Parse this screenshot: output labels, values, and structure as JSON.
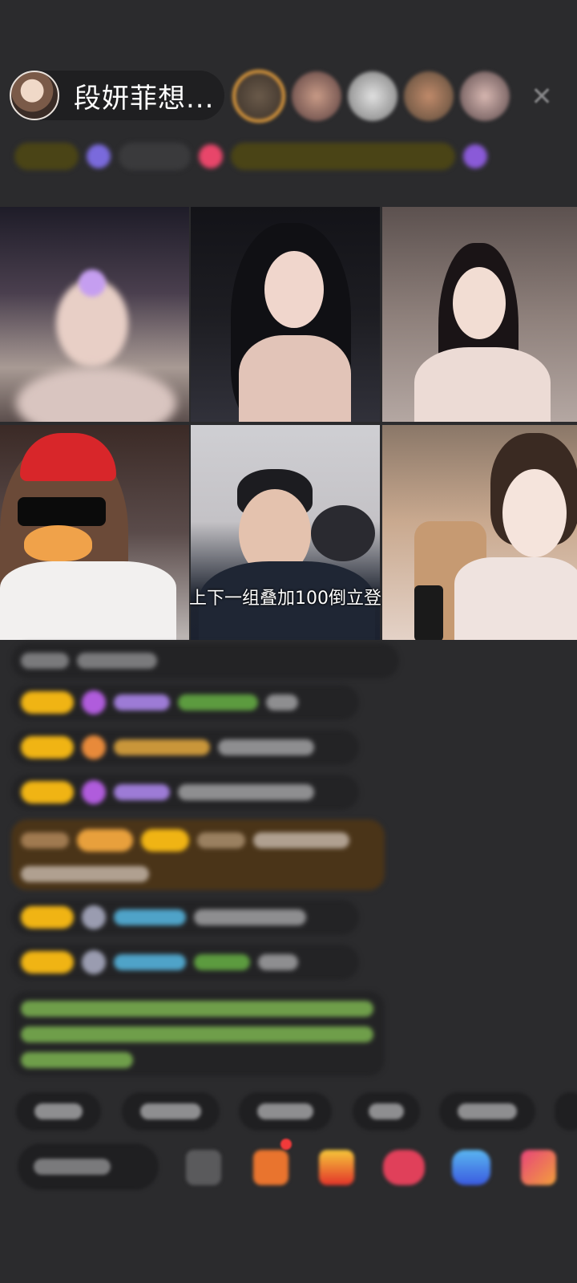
{
  "host": {
    "name": "段妍菲想..."
  },
  "colors": {
    "background": "#2b2b2d",
    "badge_gold": "#f0b414",
    "viewer_ring": "#e39d3c",
    "chat_green": "#7fbf3f",
    "chat_blue": "#4fa3c8",
    "chat_purple": "#b05cdc"
  },
  "icons": {
    "close": "close-icon",
    "gift": "gift-icon",
    "emoji": "emoji-icon"
  },
  "video": {
    "subtitle": "上下一组叠加100倒立登"
  }
}
